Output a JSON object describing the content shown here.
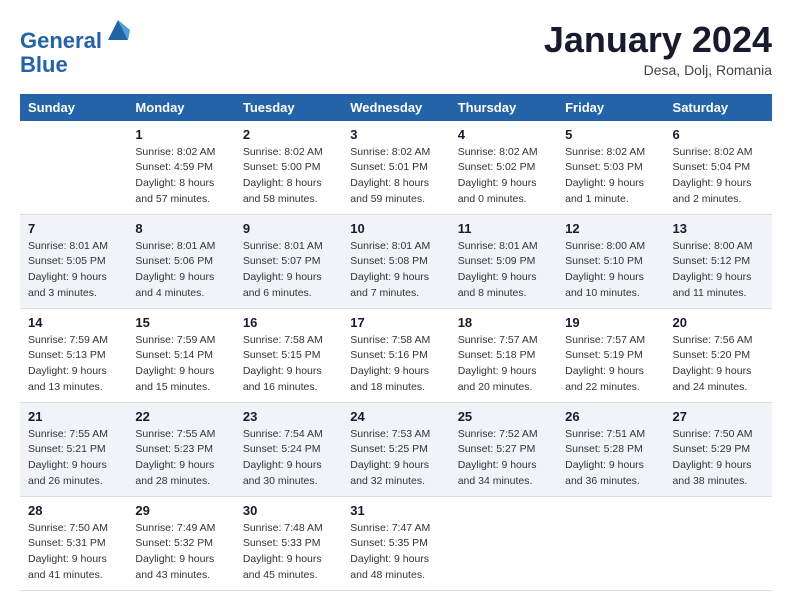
{
  "header": {
    "logo_line1": "General",
    "logo_line2": "Blue",
    "month_title": "January 2024",
    "subtitle": "Desa, Dolj, Romania"
  },
  "weekdays": [
    "Sunday",
    "Monday",
    "Tuesday",
    "Wednesday",
    "Thursday",
    "Friday",
    "Saturday"
  ],
  "weeks": [
    [
      {
        "day": "",
        "info": ""
      },
      {
        "day": "1",
        "info": "Sunrise: 8:02 AM\nSunset: 4:59 PM\nDaylight: 8 hours\nand 57 minutes."
      },
      {
        "day": "2",
        "info": "Sunrise: 8:02 AM\nSunset: 5:00 PM\nDaylight: 8 hours\nand 58 minutes."
      },
      {
        "day": "3",
        "info": "Sunrise: 8:02 AM\nSunset: 5:01 PM\nDaylight: 8 hours\nand 59 minutes."
      },
      {
        "day": "4",
        "info": "Sunrise: 8:02 AM\nSunset: 5:02 PM\nDaylight: 9 hours\nand 0 minutes."
      },
      {
        "day": "5",
        "info": "Sunrise: 8:02 AM\nSunset: 5:03 PM\nDaylight: 9 hours\nand 1 minute."
      },
      {
        "day": "6",
        "info": "Sunrise: 8:02 AM\nSunset: 5:04 PM\nDaylight: 9 hours\nand 2 minutes."
      }
    ],
    [
      {
        "day": "7",
        "info": "Sunrise: 8:01 AM\nSunset: 5:05 PM\nDaylight: 9 hours\nand 3 minutes."
      },
      {
        "day": "8",
        "info": "Sunrise: 8:01 AM\nSunset: 5:06 PM\nDaylight: 9 hours\nand 4 minutes."
      },
      {
        "day": "9",
        "info": "Sunrise: 8:01 AM\nSunset: 5:07 PM\nDaylight: 9 hours\nand 6 minutes."
      },
      {
        "day": "10",
        "info": "Sunrise: 8:01 AM\nSunset: 5:08 PM\nDaylight: 9 hours\nand 7 minutes."
      },
      {
        "day": "11",
        "info": "Sunrise: 8:01 AM\nSunset: 5:09 PM\nDaylight: 9 hours\nand 8 minutes."
      },
      {
        "day": "12",
        "info": "Sunrise: 8:00 AM\nSunset: 5:10 PM\nDaylight: 9 hours\nand 10 minutes."
      },
      {
        "day": "13",
        "info": "Sunrise: 8:00 AM\nSunset: 5:12 PM\nDaylight: 9 hours\nand 11 minutes."
      }
    ],
    [
      {
        "day": "14",
        "info": "Sunrise: 7:59 AM\nSunset: 5:13 PM\nDaylight: 9 hours\nand 13 minutes."
      },
      {
        "day": "15",
        "info": "Sunrise: 7:59 AM\nSunset: 5:14 PM\nDaylight: 9 hours\nand 15 minutes."
      },
      {
        "day": "16",
        "info": "Sunrise: 7:58 AM\nSunset: 5:15 PM\nDaylight: 9 hours\nand 16 minutes."
      },
      {
        "day": "17",
        "info": "Sunrise: 7:58 AM\nSunset: 5:16 PM\nDaylight: 9 hours\nand 18 minutes."
      },
      {
        "day": "18",
        "info": "Sunrise: 7:57 AM\nSunset: 5:18 PM\nDaylight: 9 hours\nand 20 minutes."
      },
      {
        "day": "19",
        "info": "Sunrise: 7:57 AM\nSunset: 5:19 PM\nDaylight: 9 hours\nand 22 minutes."
      },
      {
        "day": "20",
        "info": "Sunrise: 7:56 AM\nSunset: 5:20 PM\nDaylight: 9 hours\nand 24 minutes."
      }
    ],
    [
      {
        "day": "21",
        "info": "Sunrise: 7:55 AM\nSunset: 5:21 PM\nDaylight: 9 hours\nand 26 minutes."
      },
      {
        "day": "22",
        "info": "Sunrise: 7:55 AM\nSunset: 5:23 PM\nDaylight: 9 hours\nand 28 minutes."
      },
      {
        "day": "23",
        "info": "Sunrise: 7:54 AM\nSunset: 5:24 PM\nDaylight: 9 hours\nand 30 minutes."
      },
      {
        "day": "24",
        "info": "Sunrise: 7:53 AM\nSunset: 5:25 PM\nDaylight: 9 hours\nand 32 minutes."
      },
      {
        "day": "25",
        "info": "Sunrise: 7:52 AM\nSunset: 5:27 PM\nDaylight: 9 hours\nand 34 minutes."
      },
      {
        "day": "26",
        "info": "Sunrise: 7:51 AM\nSunset: 5:28 PM\nDaylight: 9 hours\nand 36 minutes."
      },
      {
        "day": "27",
        "info": "Sunrise: 7:50 AM\nSunset: 5:29 PM\nDaylight: 9 hours\nand 38 minutes."
      }
    ],
    [
      {
        "day": "28",
        "info": "Sunrise: 7:50 AM\nSunset: 5:31 PM\nDaylight: 9 hours\nand 41 minutes."
      },
      {
        "day": "29",
        "info": "Sunrise: 7:49 AM\nSunset: 5:32 PM\nDaylight: 9 hours\nand 43 minutes."
      },
      {
        "day": "30",
        "info": "Sunrise: 7:48 AM\nSunset: 5:33 PM\nDaylight: 9 hours\nand 45 minutes."
      },
      {
        "day": "31",
        "info": "Sunrise: 7:47 AM\nSunset: 5:35 PM\nDaylight: 9 hours\nand 48 minutes."
      },
      {
        "day": "",
        "info": ""
      },
      {
        "day": "",
        "info": ""
      },
      {
        "day": "",
        "info": ""
      }
    ]
  ]
}
